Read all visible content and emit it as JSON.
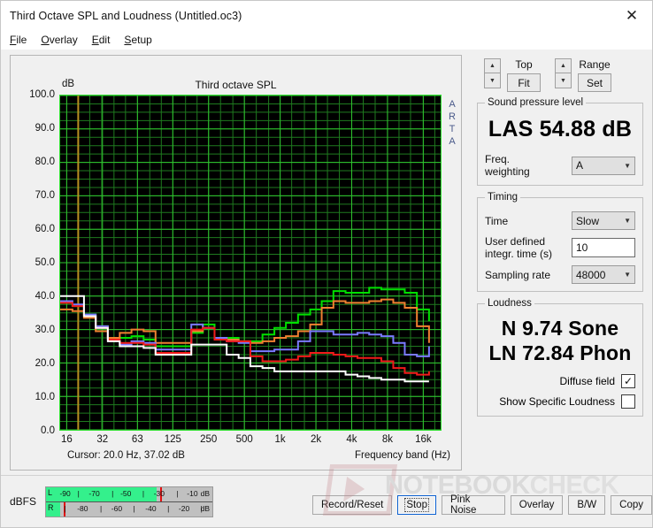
{
  "window": {
    "title": "Third Octave SPL and Loudness (Untitled.oc3)",
    "close_icon": "close-icon"
  },
  "menu": {
    "items": [
      {
        "label": "File",
        "accel": "F"
      },
      {
        "label": "Overlay",
        "accel": "O"
      },
      {
        "label": "Edit",
        "accel": "E"
      },
      {
        "label": "Setup",
        "accel": "S"
      }
    ]
  },
  "graph": {
    "y_unit": "dB",
    "title": "Third octave SPL",
    "watermark": "ARTA",
    "cursor": "Cursor:   20.0 Hz, 37.02 dB",
    "x_axis_label": "Frequency band (Hz)"
  },
  "controls": {
    "top": {
      "label": "Top",
      "button": "Fit",
      "up": "▲",
      "down": "▼"
    },
    "range": {
      "label": "Range",
      "button": "Set",
      "up": "▲",
      "down": "▼"
    },
    "spl": {
      "legend": "Sound pressure level",
      "reading": "LAS 54.88 dB",
      "weighting_label": "Freq. weighting",
      "weighting_value": "A"
    },
    "timing": {
      "legend": "Timing",
      "time_label": "Time",
      "time_value": "Slow",
      "integr_label": "User defined integr. time (s)",
      "integr_line1": "User defined",
      "integr_line2": "integr. time (s)",
      "integr_value": "10",
      "sampling_label": "Sampling rate",
      "sampling_value": "48000"
    },
    "loudness": {
      "legend": "Loudness",
      "sone": "N 9.74 Sone",
      "phon": "LN 72.84 Phon",
      "diffuse_label": "Diffuse field",
      "diffuse_checked": "✓",
      "specific_label": "Show Specific Loudness",
      "specific_checked": ""
    }
  },
  "meter": {
    "label": "dBFS",
    "left": {
      "channel": "L",
      "unit": "dB",
      "fill_pct": 66.5,
      "peak_pct": 68.5,
      "ticks": [
        {
          "t": "-90",
          "p": 11.5
        },
        {
          "t": "|",
          "p": 19.5
        },
        {
          "t": "-70",
          "p": 29
        },
        {
          "t": "|",
          "p": 40
        },
        {
          "t": "-50",
          "p": 48
        },
        {
          "t": "|",
          "p": 58.5
        },
        {
          "t": "-30",
          "p": 68
        },
        {
          "t": "|",
          "p": 79
        },
        {
          "t": "-10",
          "p": 88
        }
      ]
    },
    "right": {
      "channel": "R",
      "unit": "dB",
      "fill_pct": 8.5,
      "peak_pct": 10.5,
      "ticks": [
        {
          "t": "|",
          "p": 11.5
        },
        {
          "t": "-80",
          "p": 22
        },
        {
          "t": "|",
          "p": 33
        },
        {
          "t": "-60",
          "p": 42.5
        },
        {
          "t": "|",
          "p": 53
        },
        {
          "t": "-40",
          "p": 63
        },
        {
          "t": "|",
          "p": 73.5
        },
        {
          "t": "-20",
          "p": 83
        },
        {
          "t": "|",
          "p": 93.5
        }
      ]
    }
  },
  "buttons": [
    {
      "label": "Record/Reset",
      "focus": false
    },
    {
      "label": "Stop",
      "focus": true
    },
    {
      "label": "Pink Noise",
      "focus": false
    },
    {
      "label": "Overlay",
      "focus": false
    },
    {
      "label": "B/W",
      "focus": false
    },
    {
      "label": "Copy",
      "focus": false
    }
  ],
  "watermark": {
    "text1": "NOTEBOOK",
    "text2": "CHECK"
  },
  "chart_data": {
    "type": "line",
    "title": "Third octave SPL",
    "xlabel": "Frequency band (Hz)",
    "ylabel": "dB",
    "ylim": [
      0,
      100
    ],
    "ytick_step": 10,
    "yticks": [
      "100.0",
      "90.0",
      "80.0",
      "70.0",
      "60.0",
      "50.0",
      "40.0",
      "30.0",
      "20.0",
      "10.0",
      "0.0"
    ],
    "x_log": true,
    "xticks": [
      "16",
      "32",
      "63",
      "125",
      "250",
      "500",
      "1k",
      "2k",
      "4k",
      "8k",
      "16k"
    ],
    "xtick_freqs": [
      16,
      32,
      63,
      125,
      250,
      500,
      1000,
      2000,
      4000,
      8000,
      16000
    ],
    "grid": true,
    "bg": "#000000",
    "grid_color": "#1f7a1f",
    "grid_major_color": "#2fc42f",
    "cursor_marker": {
      "freq_hz": 20.0,
      "level_db": 37.02,
      "color": "#b89020"
    },
    "bands_hz": [
      16,
      20,
      25,
      31.5,
      40,
      50,
      63,
      80,
      100,
      125,
      160,
      200,
      250,
      315,
      400,
      500,
      630,
      800,
      1000,
      1250,
      1600,
      2000,
      2500,
      3150,
      4000,
      5000,
      6300,
      8000,
      10000,
      12500,
      16000,
      20000
    ],
    "series": [
      {
        "name": "green",
        "color": "#00e000",
        "values": [
          38.0,
          37.0,
          34.5,
          31.0,
          27.5,
          27.5,
          28.0,
          27.0,
          25.0,
          25.0,
          25.0,
          29.0,
          31.5,
          27.5,
          27.5,
          26.5,
          26.5,
          28.5,
          30.5,
          32.0,
          34.5,
          36.0,
          38.5,
          41.5,
          41.0,
          41.0,
          42.5,
          42.0,
          42.0,
          41.0,
          36.0,
          32.5,
          31.5
        ]
      },
      {
        "name": "orange",
        "color": "#ef8030",
        "values": [
          36.0,
          35.5,
          33.5,
          29.5,
          27.5,
          29.0,
          30.0,
          29.5,
          26.0,
          26.0,
          26.0,
          29.5,
          30.5,
          27.5,
          27.0,
          26.5,
          26.0,
          26.5,
          27.5,
          28.0,
          29.5,
          31.5,
          36.5,
          38.5,
          38.0,
          38.0,
          38.5,
          39.0,
          38.0,
          36.5,
          31.0,
          26.0,
          25.0
        ]
      },
      {
        "name": "blue",
        "color": "#7a7aff",
        "values": [
          38.5,
          37.5,
          34.5,
          31.0,
          27.0,
          25.5,
          26.5,
          26.0,
          24.0,
          24.0,
          24.0,
          31.5,
          30.5,
          27.5,
          26.5,
          26.0,
          23.5,
          23.5,
          24.0,
          24.0,
          26.5,
          29.5,
          29.5,
          28.5,
          28.5,
          29.0,
          28.5,
          28.0,
          26.0,
          22.5,
          22.0,
          25.0,
          20.5
        ]
      },
      {
        "name": "red",
        "color": "#f21a1a",
        "values": [
          38.0,
          37.0,
          34.0,
          30.5,
          27.0,
          26.0,
          26.0,
          25.5,
          23.0,
          23.0,
          23.0,
          30.0,
          30.5,
          27.0,
          26.5,
          26.5,
          22.0,
          20.5,
          20.5,
          21.0,
          22.0,
          23.0,
          23.0,
          22.5,
          22.0,
          21.5,
          21.5,
          20.5,
          18.5,
          17.0,
          16.5,
          17.5,
          14.0
        ]
      },
      {
        "name": "white",
        "color": "#ffffff",
        "values": [
          40.0,
          40.0,
          34.0,
          30.5,
          26.5,
          25.0,
          25.0,
          24.5,
          22.5,
          22.5,
          22.5,
          25.5,
          25.5,
          25.5,
          22.5,
          21.5,
          19.0,
          18.5,
          17.5,
          17.5,
          17.5,
          17.5,
          17.5,
          17.5,
          16.5,
          16.0,
          15.5,
          15.0,
          15.0,
          14.5,
          14.5,
          14.5,
          14.0
        ]
      }
    ]
  }
}
